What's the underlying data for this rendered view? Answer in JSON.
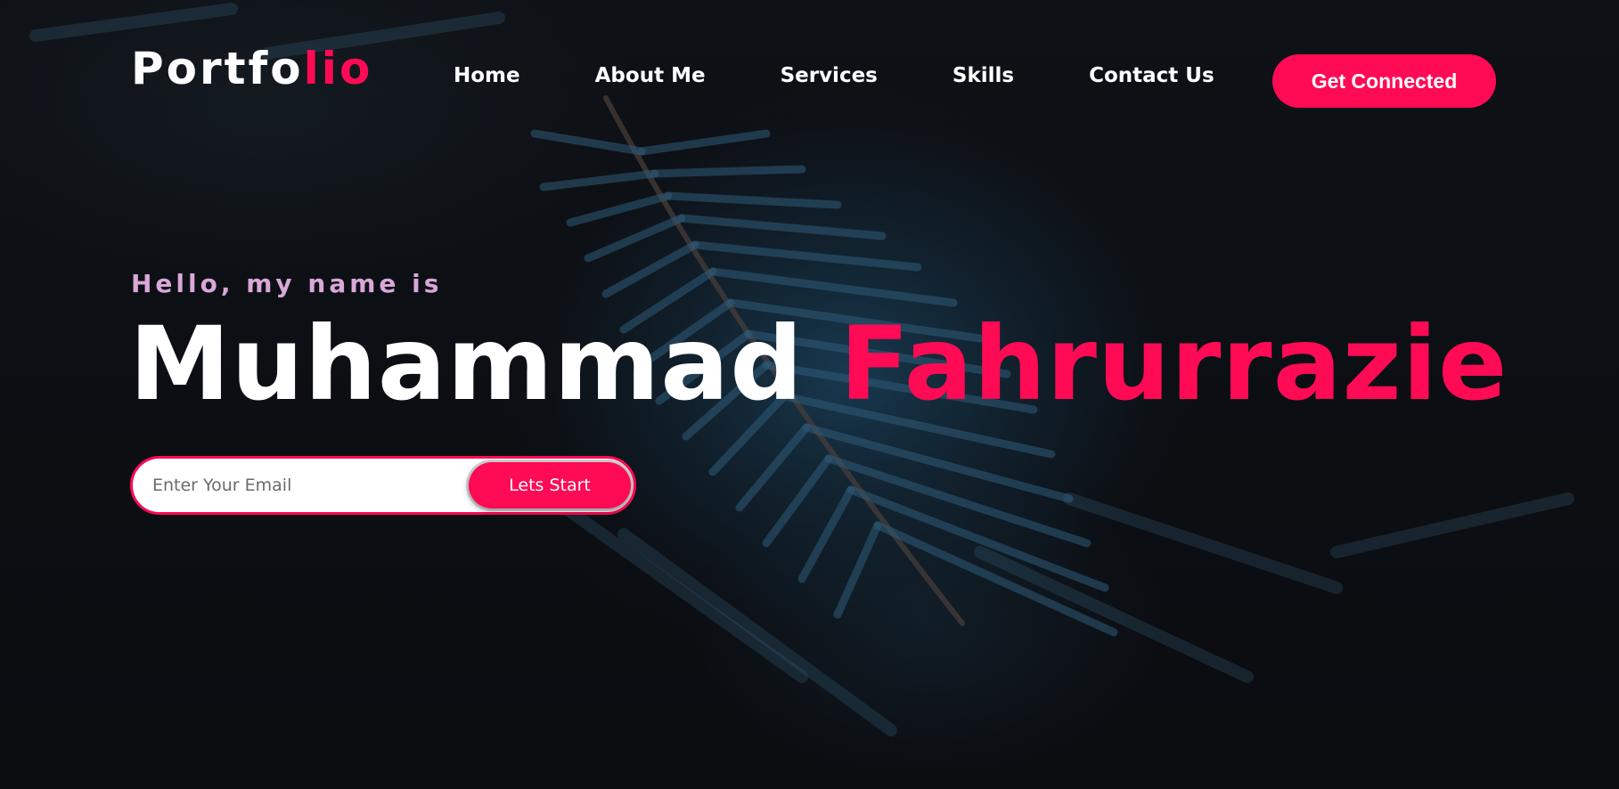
{
  "header": {
    "logo_primary": "Portfo",
    "logo_accent": "lio",
    "nav": {
      "home": "Home",
      "about": "About Me",
      "services": "Services",
      "skills": "Skills",
      "contact": "Contact Us"
    },
    "cta_label": "Get Connected"
  },
  "hero": {
    "greeting": "Hello, my name is",
    "first_name": "Muhammad",
    "last_name": "Fahrurrazie",
    "signup": {
      "email_placeholder": "Enter Your Email",
      "email_value": "",
      "button_label": "Lets Start"
    }
  },
  "colors": {
    "accent": "#ff0a54",
    "greeting": "#d9a7d8",
    "background": "#0b0d10",
    "text": "#ffffff"
  },
  "background_image": "dark-blue-fir-branch-photo"
}
